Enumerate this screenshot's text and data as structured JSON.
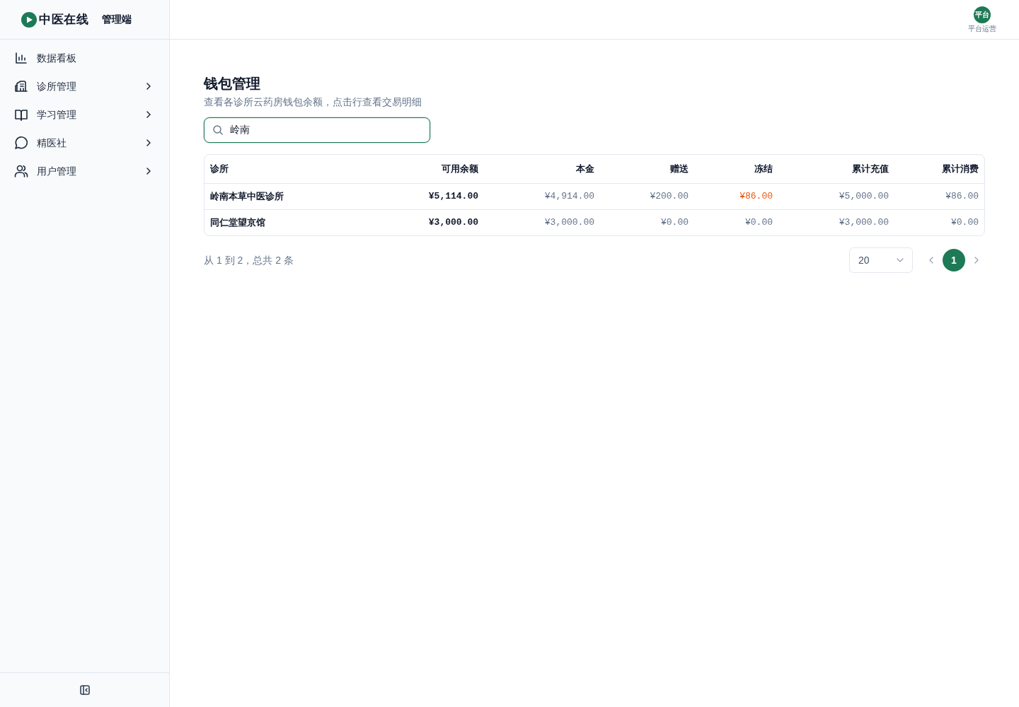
{
  "sidebar": {
    "logo": {
      "name": "中医在线",
      "suffix": "管理端"
    },
    "items": [
      {
        "label": "数据看板",
        "expandable": false
      },
      {
        "label": "诊所管理",
        "expandable": true
      },
      {
        "label": "学习管理",
        "expandable": true
      },
      {
        "label": "精医社",
        "expandable": true
      },
      {
        "label": "用户管理",
        "expandable": true
      }
    ]
  },
  "header": {
    "user": {
      "avatar_text": "平台",
      "role": "平台运营"
    }
  },
  "page": {
    "title": "钱包管理",
    "subtitle": "查看各诊所云药房钱包余额，点击行查看交易明细",
    "search": {
      "value": "岭南",
      "focused": true
    },
    "table": {
      "columns": [
        "诊所",
        "可用余额",
        "本金",
        "赠送",
        "冻结",
        "累计充值",
        "累计消费"
      ],
      "rows": [
        {
          "clinic": "岭南本草中医诊所",
          "available": "¥5,114.00",
          "principal": "¥4,914.00",
          "bonus": "¥200.00",
          "frozen": "¥86.00",
          "frozen_highlighted": true,
          "total_recharge": "¥5,000.00",
          "total_spent": "¥86.00"
        },
        {
          "clinic": "同仁堂望京馆",
          "available": "¥3,000.00",
          "principal": "¥3,000.00",
          "bonus": "¥0.00",
          "frozen": "¥0.00",
          "frozen_highlighted": false,
          "total_recharge": "¥3,000.00",
          "total_spent": "¥0.00"
        }
      ]
    },
    "pagination": {
      "summary": "从 1 到 2，总共 2 条",
      "page_size": "20",
      "pages": [
        {
          "label": "1",
          "selected": true
        }
      ]
    }
  }
}
